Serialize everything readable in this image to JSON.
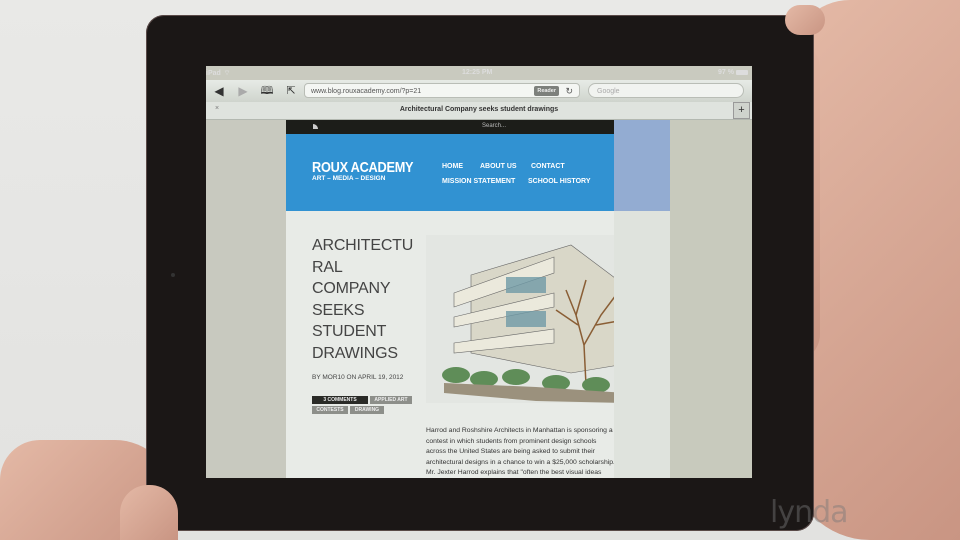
{
  "status_bar": {
    "carrier": "iPad",
    "time": "12:25 PM",
    "battery": "97 %"
  },
  "browser": {
    "back_icon": "back-arrow-icon",
    "forward_icon": "forward-arrow-icon",
    "bookmarks_icon": "bookmarks-book-icon",
    "share_icon": "share-icon",
    "url": "www.blog.rouxacademy.com/?p=21",
    "reader_label": "Reader",
    "reload_icon": "reload-icon",
    "search_placeholder": "Google",
    "tab_title": "Architectural Company seeks student drawings",
    "tab_close": "×",
    "new_tab": "+"
  },
  "site": {
    "search_placeholder": "Search...",
    "logo": "ROUX ACADEMY",
    "tagline": "ART – MEDIA – DESIGN",
    "nav": [
      "HOME",
      "ABOUT US",
      "CONTACT",
      "MISSION STATEMENT",
      "SCHOOL HISTORY"
    ],
    "colors": {
      "header": "#3192d2",
      "topbar": "#1c1d19"
    }
  },
  "post": {
    "title_lines": [
      "ARCHITECTU",
      "RAL",
      "COMPANY",
      "SEEKS",
      "STUDENT",
      "DRAWINGS"
    ],
    "meta": "BY MOR10 ON APRIL 19, 2012",
    "tags": [
      "3 COMMENTS",
      "APPLIED ART",
      "CONTESTS",
      "DRAWING"
    ],
    "image_alt": "Architectural sketch of modern building with tree",
    "body_lines": [
      "Harrod and Roshshire Architects in Manhattan is sponsoring a",
      "contest in which students from prominent design schools",
      "across the United States are being asked to submit their",
      "architectural designs in a chance to win a $25,000 scholarship.",
      "Mr. Jexter Harrod explains that \"often the best visual ideas"
    ]
  },
  "watermark": "lynda"
}
